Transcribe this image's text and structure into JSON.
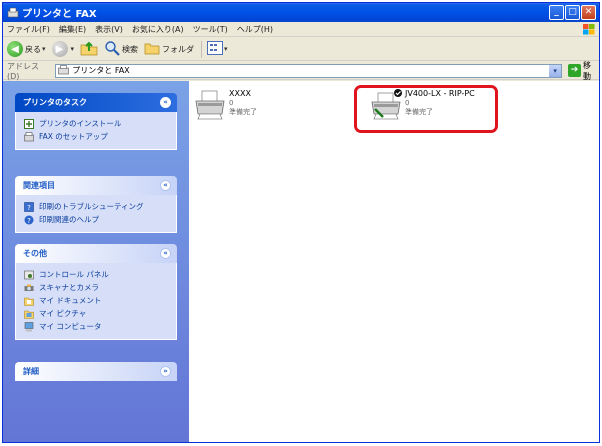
{
  "window": {
    "title": "プリンタと FAX"
  },
  "menu": [
    "ファイル(F)",
    "編集(E)",
    "表示(V)",
    "お気に入り(A)",
    "ツール(T)",
    "ヘルプ(H)"
  ],
  "toolbar": {
    "back": "戻る",
    "search": "検索",
    "folders": "フォルダ"
  },
  "address": {
    "label": "アドレス(D)",
    "value": "プリンタと FAX",
    "go": "移動"
  },
  "sidebar": {
    "printer_tasks": {
      "title": "プリンタのタスク",
      "items": [
        "プリンタのインストール",
        "FAX のセットアップ"
      ]
    },
    "related": {
      "title": "関連項目",
      "items": [
        "印刷のトラブルシューティング",
        "印刷関連のヘルプ"
      ]
    },
    "other": {
      "title": "その他",
      "items": [
        "コントロール パネル",
        "スキャナとカメラ",
        "マイ ドキュメント",
        "マイ ピクチャ",
        "マイ コンピュータ"
      ]
    },
    "details": {
      "title": "詳細"
    }
  },
  "printers": [
    {
      "name": "XXXX",
      "jobs": "0",
      "status": "準備完了"
    },
    {
      "name": "JV400-LX - RIP-PC",
      "jobs": "0",
      "status": "準備完了"
    }
  ],
  "colors": {
    "highlight": "#e0141d",
    "titlebar": "#0054e3",
    "sidebar": "#6f8fdf"
  }
}
